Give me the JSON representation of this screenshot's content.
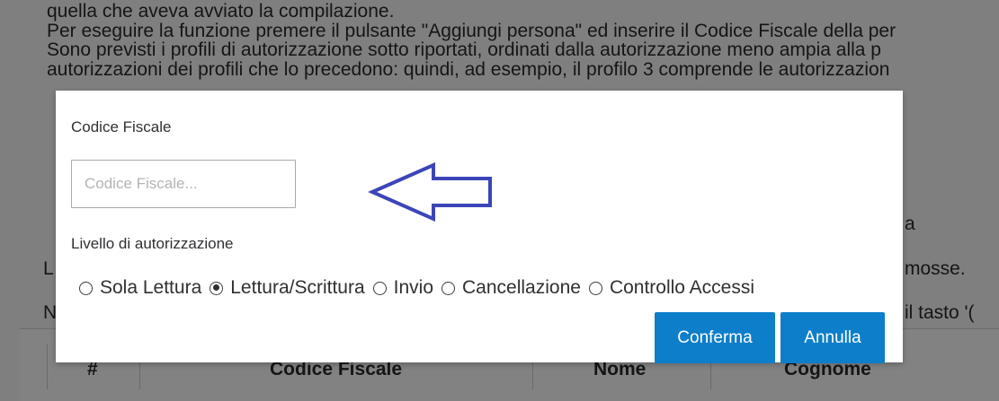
{
  "background": {
    "lines": [
      "quella che aveva avviato la compilazione.",
      "Per eseguire la funzione premere il pulsante \"Aggiungi persona\" ed inserire il Codice Fiscale della per",
      "Sono previsti i profili di autorizzazione sotto riportati, ordinati dalla autorizzazione meno ampia alla p",
      "autorizzazioni dei profili che lo precedono: quindi, ad esempio, il profilo 3 comprende le autorizzazion"
    ],
    "right_fragment_1": "a",
    "right_fragment_2": "mosse.",
    "right_fragment_3": "il tasto '(",
    "left_fragment_1": "L",
    "left_fragment_2": "N",
    "table_headers": {
      "hash": "#",
      "codice_fiscale": "Codice Fiscale",
      "nome": "Nome",
      "cognome": "Cognome"
    }
  },
  "modal": {
    "codice_fiscale_label": "Codice Fiscale",
    "codice_fiscale_placeholder": "Codice Fiscale...",
    "codice_fiscale_value": "",
    "livello_label": "Livello di autorizzazione",
    "options": [
      {
        "label": "Sola Lettura",
        "checked": false
      },
      {
        "label": "Lettura/Scrittura",
        "checked": true
      },
      {
        "label": "Invio",
        "checked": false
      },
      {
        "label": "Cancellazione",
        "checked": false
      },
      {
        "label": "Controllo Accessi",
        "checked": false
      }
    ],
    "confirm_label": "Conferma",
    "cancel_label": "Annulla",
    "button_color": "#0d7ec9",
    "arrow_color": "#3c45b8",
    "arrow_icon": "left-arrow-icon"
  }
}
